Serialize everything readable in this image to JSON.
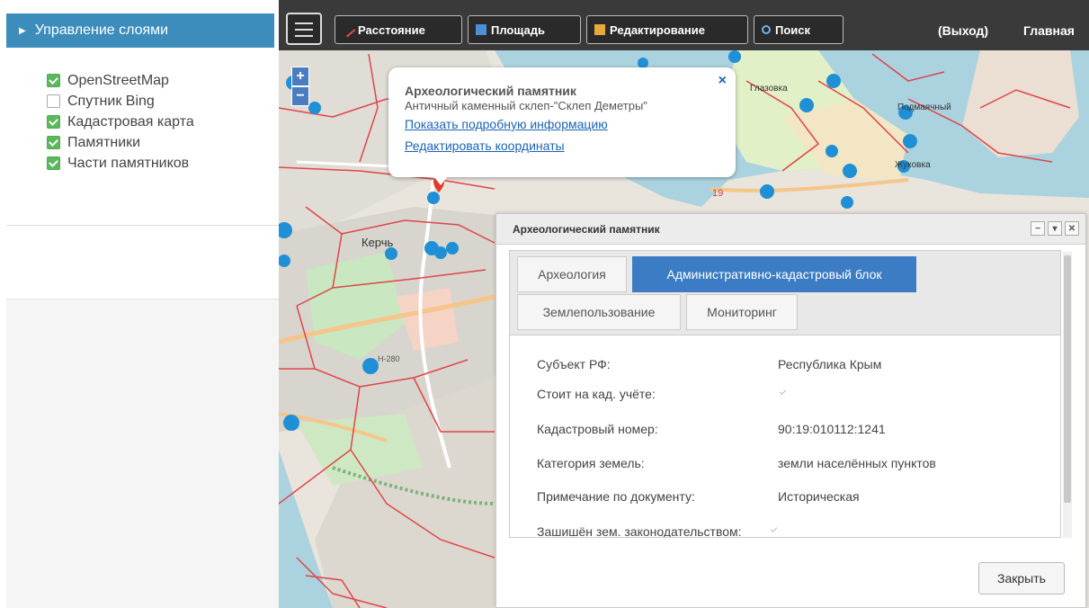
{
  "sidebar": {
    "header": "Управление слоями",
    "layers": [
      {
        "label": "OpenStreetMap",
        "checked": true
      },
      {
        "label": "Спутник Bing",
        "checked": false
      },
      {
        "label": "Кадастровая карта",
        "checked": true
      },
      {
        "label": "Памятники",
        "checked": true
      },
      {
        "label": "Части памятников",
        "checked": true
      }
    ]
  },
  "toolbar": {
    "distance": "Расстояние",
    "area": "Площадь",
    "edit": "Редактирование",
    "search": "Поиск",
    "logout": "(Выход)",
    "home": "Главная"
  },
  "map": {
    "zoom_in": "+",
    "zoom_out": "−",
    "labels": {
      "kerch": "Керчь",
      "podmayachny": "Подмаячный",
      "zhukovka": "Жуковка",
      "glazovka": "Глазовка",
      "road_n19": "19",
      "road_280": "Н-280"
    }
  },
  "popup": {
    "title": "Археологический памятник",
    "subtitle": "Античный каменный склеп-\"Склеп Деметры\"",
    "link_details": "Показать подробную информацию",
    "link_coords": "Редактировать координаты",
    "close": "×"
  },
  "dialog": {
    "title": "Археологический памятник",
    "tabs": [
      {
        "label": "Археология",
        "active": false
      },
      {
        "label": "Административно-кадастровый блок",
        "active": true
      },
      {
        "label": "Землепользование",
        "active": false
      },
      {
        "label": "Мониторинг",
        "active": false
      }
    ],
    "fields": [
      {
        "label": "Субъект РФ:",
        "value": "Республика Крым"
      },
      {
        "label": "Стоит на кад. учёте:",
        "value": "",
        "checkbox": true
      },
      {
        "label": "Кадастровый номер:",
        "value": "90:19:010112:1241"
      },
      {
        "label": "Категория земель:",
        "value": "земли населённых пунктов"
      },
      {
        "label": "Примечание по документу:",
        "value": "Историческая"
      },
      {
        "label": "Зашишён зем. законодательством:",
        "value": "",
        "checkbox": true
      }
    ],
    "close_button": "Закрыть"
  },
  "colors": {
    "accent": "#3c8dbc",
    "tab_active": "#3c7cc4",
    "checkbox_on": "#5cb85c",
    "toolbar_bg": "#3a3a3a",
    "marker": "#1f8fd6",
    "boundary": "#e0444a"
  }
}
